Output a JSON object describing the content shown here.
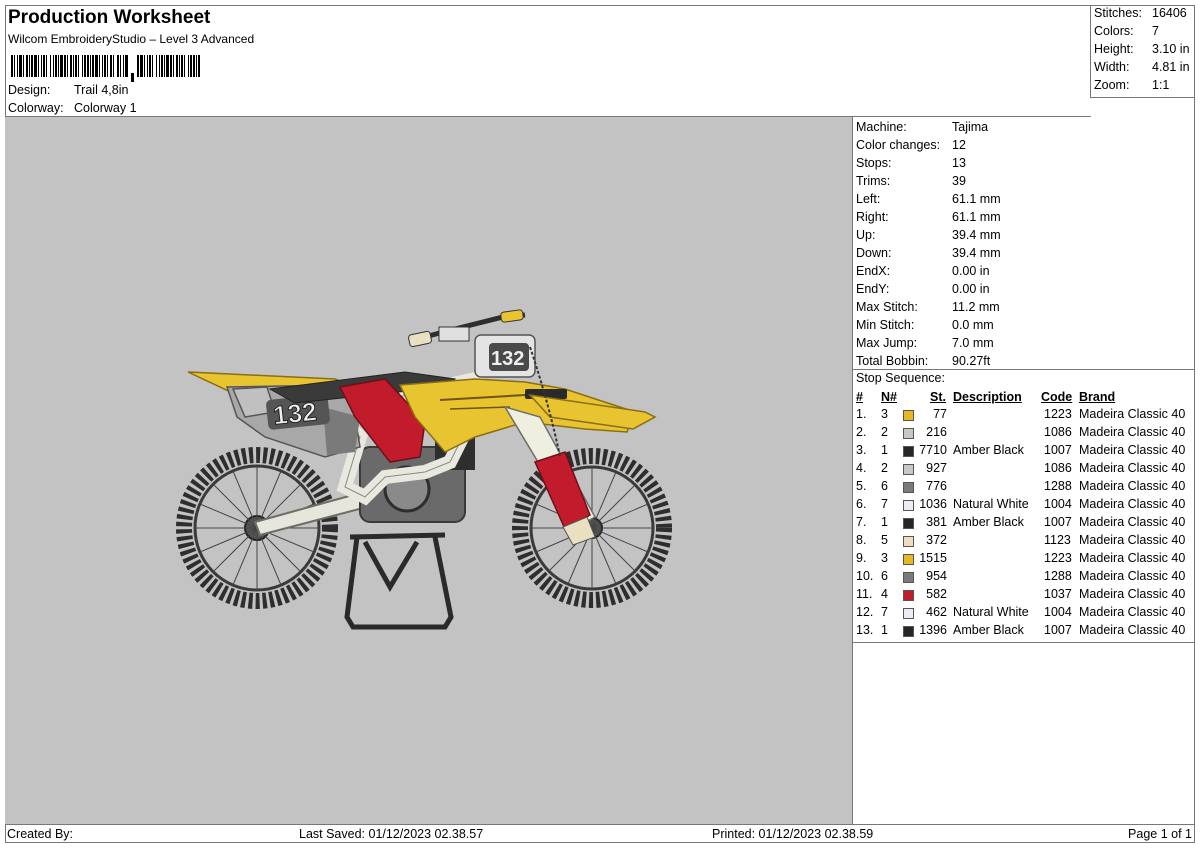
{
  "header": {
    "title": "Production Worksheet",
    "subtitle": "Wilcom EmbroideryStudio – Level 3 Advanced",
    "design_label": "Design:",
    "design_value": "Trail 4,8in",
    "colorway_label": "Colorway:",
    "colorway_value": "Colorway 1"
  },
  "summary": [
    {
      "label": "Stitches:",
      "value": "16406"
    },
    {
      "label": "Colors:",
      "value": "7"
    },
    {
      "label": "Height:",
      "value": "3.10 in"
    },
    {
      "label": "Width:",
      "value": "4.81 in"
    },
    {
      "label": "Zoom:",
      "value": "1:1"
    }
  ],
  "machine_info": [
    {
      "label": "Machine:",
      "value": "Tajima"
    },
    {
      "label": "Color changes:",
      "value": "12"
    },
    {
      "label": "Stops:",
      "value": "13"
    },
    {
      "label": "Trims:",
      "value": "39"
    },
    {
      "label": "Left:",
      "value": "61.1 mm"
    },
    {
      "label": "Right:",
      "value": "61.1 mm"
    },
    {
      "label": "Up:",
      "value": "39.4 mm"
    },
    {
      "label": "Down:",
      "value": "39.4 mm"
    },
    {
      "label": "EndX:",
      "value": "0.00 in"
    },
    {
      "label": "EndY:",
      "value": "0.00 in"
    },
    {
      "label": "Max Stitch:",
      "value": "11.2 mm"
    },
    {
      "label": "Min Stitch:",
      "value": "0.0 mm"
    },
    {
      "label": "Max Jump:",
      "value": "7.0 mm"
    },
    {
      "label": "Total Bobbin:",
      "value": "90.27ft"
    }
  ],
  "stop_sequence": {
    "title": "Stop Sequence:",
    "headers": {
      "num": "#",
      "needle": "N#",
      "stitches": "St.",
      "description": "Description",
      "code": "Code",
      "brand": "Brand"
    },
    "rows": [
      {
        "num": "1.",
        "needle": "3",
        "color": "#e8b820",
        "stitches": "77",
        "description": "",
        "code": "1223",
        "brand": "Madeira Classic 40"
      },
      {
        "num": "2.",
        "needle": "2",
        "color": "#c8c8c8",
        "stitches": "216",
        "description": "",
        "code": "1086",
        "brand": "Madeira Classic 40"
      },
      {
        "num": "3.",
        "needle": "1",
        "color": "#262626",
        "stitches": "7710",
        "description": "Amber Black",
        "code": "1007",
        "brand": "Madeira Classic 40"
      },
      {
        "num": "4.",
        "needle": "2",
        "color": "#c8c8c8",
        "stitches": "927",
        "description": "",
        "code": "1086",
        "brand": "Madeira Classic 40"
      },
      {
        "num": "5.",
        "needle": "6",
        "color": "#7a7a7a",
        "stitches": "776",
        "description": "",
        "code": "1288",
        "brand": "Madeira Classic 40"
      },
      {
        "num": "6.",
        "needle": "7",
        "color": "#ececf2",
        "stitches": "1036",
        "description": "Natural White",
        "code": "1004",
        "brand": "Madeira Classic 40"
      },
      {
        "num": "7.",
        "needle": "1",
        "color": "#262626",
        "stitches": "381",
        "description": "Amber Black",
        "code": "1007",
        "brand": "Madeira Classic 40"
      },
      {
        "num": "8.",
        "needle": "5",
        "color": "#f0dcc0",
        "stitches": "372",
        "description": "",
        "code": "1123",
        "brand": "Madeira Classic 40"
      },
      {
        "num": "9.",
        "needle": "3",
        "color": "#e8b820",
        "stitches": "1515",
        "description": "",
        "code": "1223",
        "brand": "Madeira Classic 40"
      },
      {
        "num": "10.",
        "needle": "6",
        "color": "#7a7a7a",
        "stitches": "954",
        "description": "",
        "code": "1288",
        "brand": "Madeira Classic 40"
      },
      {
        "num": "11.",
        "needle": "4",
        "color": "#c21c2c",
        "stitches": "582",
        "description": "",
        "code": "1037",
        "brand": "Madeira Classic 40"
      },
      {
        "num": "12.",
        "needle": "7",
        "color": "#ececf2",
        "stitches": "462",
        "description": "Natural White",
        "code": "1004",
        "brand": "Madeira Classic 40"
      },
      {
        "num": "13.",
        "needle": "1",
        "color": "#262626",
        "stitches": "1396",
        "description": "Amber Black",
        "code": "1007",
        "brand": "Madeira Classic 40"
      }
    ]
  },
  "design_image": {
    "number_plate_text": "132",
    "canvas_color": "#c3c3c3"
  },
  "footer": {
    "created_by": "Created By:",
    "last_saved": "Last Saved: 01/12/2023 02.38.57",
    "printed": "Printed: 01/12/2023 02.38.59",
    "page": "Page 1 of 1"
  }
}
